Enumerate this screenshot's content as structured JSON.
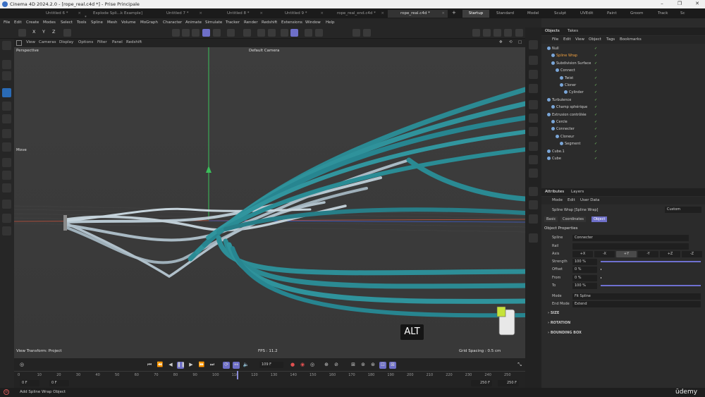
{
  "window": {
    "title": "Cinema 4D 2024.2.0 - [rope_real.c4d *] - Prise Principale"
  },
  "doc_tabs": [
    {
      "label": "Untitled 6 *",
      "active": false
    },
    {
      "label": "Explode Spli...k Example] *",
      "active": false
    },
    {
      "label": "Untitled 7 *",
      "active": false
    },
    {
      "label": "Untitled 8 *",
      "active": false
    },
    {
      "label": "Untitled 9 *",
      "active": false
    },
    {
      "label": "rope_real_end.c4d *",
      "active": false
    },
    {
      "label": "rope_real.c4d *",
      "active": true
    }
  ],
  "layouts": [
    "Startup",
    "Standard",
    "Model",
    "Sculpt",
    "UVEdit",
    "Paint",
    "Groom",
    "Track",
    "Sc"
  ],
  "menu": [
    "File",
    "Edit",
    "Create",
    "Modes",
    "Select",
    "Tools",
    "Spline",
    "Mesh",
    "Volume",
    "MoGraph",
    "Character",
    "Animate",
    "Simulate",
    "Tracker",
    "Render",
    "Redshift",
    "Extensions",
    "Window",
    "Help"
  ],
  "viewport_menu": [
    "View",
    "Cameras",
    "Display",
    "Options",
    "Filter",
    "Panel",
    "Redshift"
  ],
  "viewport": {
    "name": "Perspective",
    "camera": "Default Camera",
    "move_label": "Move",
    "view_transform": "View Transform: Project",
    "fps": "FPS : 11.2",
    "grid_spacing": "Grid Spacing : 0.5 cm",
    "alt_key": "ALT"
  },
  "objects_panel": {
    "tabs": [
      "Objects",
      "Takes"
    ],
    "menu": [
      "File",
      "Edit",
      "View",
      "Object",
      "Tags",
      "Bookmarks"
    ],
    "rows": [
      {
        "name": "Null",
        "indent": 0,
        "selected": false
      },
      {
        "name": "Spline Wrap",
        "indent": 1,
        "selected": true
      },
      {
        "name": "Subdivision Surface",
        "indent": 1,
        "selected": false
      },
      {
        "name": "Connect",
        "indent": 2,
        "selected": false
      },
      {
        "name": "Twist",
        "indent": 3,
        "selected": false
      },
      {
        "name": "Cloner",
        "indent": 3,
        "selected": false
      },
      {
        "name": "Cylinder",
        "indent": 4,
        "selected": false
      },
      {
        "name": "Turbulence",
        "indent": 0,
        "selected": false
      },
      {
        "name": "Champ sphérique",
        "indent": 1,
        "selected": false
      },
      {
        "name": "Extrusion contrôlée",
        "indent": 0,
        "selected": false
      },
      {
        "name": "Cercle",
        "indent": 1,
        "selected": false
      },
      {
        "name": "Connecter",
        "indent": 1,
        "selected": false
      },
      {
        "name": "Cloneur",
        "indent": 2,
        "selected": false
      },
      {
        "name": "Segment",
        "indent": 3,
        "selected": false
      },
      {
        "name": "Cube.1",
        "indent": 0,
        "selected": false
      },
      {
        "name": "Cube",
        "indent": 0,
        "selected": false
      }
    ]
  },
  "attributes_panel": {
    "tabs": [
      "Attributes",
      "Layers"
    ],
    "menu": [
      "Mode",
      "Edit",
      "User Data"
    ],
    "object_title": "Spline Wrap [Spline Wrap]",
    "preset": "Custom",
    "subtabs": [
      {
        "label": "Basic",
        "active": false
      },
      {
        "label": "Coordinates",
        "active": false
      },
      {
        "label": "Object",
        "active": true
      }
    ],
    "section": "Object Properties",
    "spline_label": "Spline",
    "spline_value": "Connecter",
    "rail_label": "Rail",
    "axis_label": "Axis",
    "axis_options": [
      "+X",
      "-X",
      "+Y",
      "-Y",
      "+Z",
      "-Z"
    ],
    "axis_selected": "+Y",
    "strength_label": "Strength",
    "strength_value": "100 %",
    "strength_fraction": 1.0,
    "offset_label": "Offset",
    "offset_value": "0 %",
    "offset_fraction": 0.0,
    "from_label": "From",
    "from_value": "0 %",
    "from_fraction": 0.0,
    "to_label": "To",
    "to_value": "100 %",
    "to_fraction": 1.0,
    "mode_label": "Mode",
    "mode_value": "Fit Spline",
    "endmode_label": "End Mode",
    "endmode_value": "Extend",
    "groups": [
      "SIZE",
      "ROTATION",
      "BOUNDING BOX"
    ]
  },
  "timeline": {
    "ticks": [
      "0",
      "10",
      "20",
      "30",
      "40",
      "50",
      "60",
      "70",
      "80",
      "90",
      "100",
      "110",
      "120",
      "130",
      "140",
      "150",
      "160",
      "170",
      "180",
      "190",
      "200",
      "210",
      "220",
      "230",
      "240",
      "250"
    ],
    "current_frame": "109 F",
    "start_a": "0 F",
    "start_b": "0 F",
    "end_a": "250 F",
    "end_b": "250 F"
  },
  "status": {
    "text": "Add Spline Wrap Object",
    "brand": "ūdemy"
  },
  "colors": {
    "accent": "#6e6fc8",
    "rope": "#2d8c94",
    "rope_light": "#b9c9d2",
    "selected_text": "#f0a040"
  }
}
